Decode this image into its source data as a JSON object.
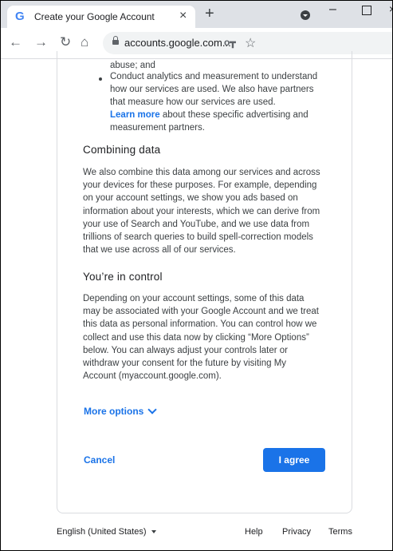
{
  "browser": {
    "tab_title": "Create your Google Account",
    "tab_favicon": "G",
    "url": "accounts.google.com..."
  },
  "bullets": {
    "line0": "abuse; and",
    "item_lines": [
      "Conduct analytics and measurement to understand",
      "how our services are used. We also have partners",
      "that measure how our services are used."
    ],
    "learn_more_link": "Learn more",
    "learn_more_rest": " about these specific advertising and",
    "last_line": "measurement partners."
  },
  "combining": {
    "heading": "Combining data",
    "lines": [
      "We also combine this data among our services and across",
      "your devices for these purposes. For example, depending",
      "on your account settings, we show you ads based on",
      "information about your interests, which we can derive from",
      "your use of Search and YouTube, and we use data from",
      "trillions of search queries to build spell-correction models",
      "that we use across all of our services."
    ]
  },
  "control": {
    "heading": "You’re in control",
    "lines": [
      "Depending on your account settings, some of this data",
      "may be associated with your Google Account and we treat",
      "this data as personal information. You can control how we",
      "collect and use this data now by clicking “More Options”",
      "below. You can always adjust your controls later or",
      "withdraw your consent for the future by visiting My",
      "Account (myaccount.google.com)."
    ]
  },
  "actions": {
    "more_options": "More options",
    "cancel": "Cancel",
    "agree": "I agree"
  },
  "footer": {
    "language": "English (United States)",
    "help": "Help",
    "privacy": "Privacy",
    "terms": "Terms"
  }
}
